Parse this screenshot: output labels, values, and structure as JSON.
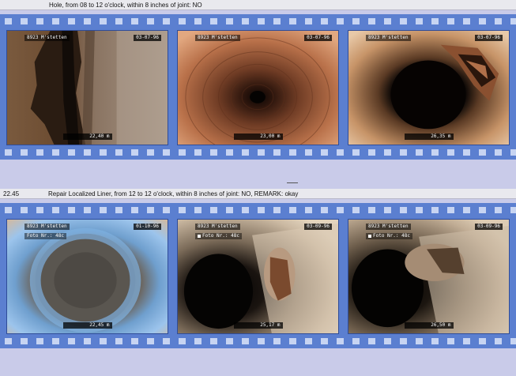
{
  "observations": [
    {
      "distance": "",
      "description": "Hole,  from 08 to 12 o'clock, within 8 inches of joint: NO",
      "frames": [
        {
          "location": "8923 M'stetten",
          "date": "03-07-96",
          "position": "22,40 m",
          "foto": "",
          "scene": "crack"
        },
        {
          "location": "8923 M'stetten",
          "date": "03-07-96",
          "position": "23,00 m",
          "foto": "",
          "scene": "rough-pipe"
        },
        {
          "location": "8923 M'stetten",
          "date": "03-07-96",
          "position": "26,35 m",
          "foto": "",
          "scene": "hole-pipe"
        }
      ]
    },
    {
      "distance": "22.45",
      "description": "Repair Localized Liner, from 12 to 12 o'clock, within 8 inches of joint: NO, REMARK: okay",
      "frames": [
        {
          "location": "8923 M'stetten",
          "date": "01-10-96",
          "position": "22,45 m",
          "foto": "Foto Nr.:   48c",
          "scene": "blue-liner"
        },
        {
          "location": "8923 M'stetten",
          "date": "03-09-96",
          "position": "25,17 m",
          "foto": "Foto Nr.:   48c",
          "scene": "liner-cut"
        },
        {
          "location": "8923 M'stetten",
          "date": "03-09-96",
          "position": "26,50 m",
          "foto": "Foto Nr.:   48c",
          "scene": "liner-cut-2"
        }
      ]
    }
  ]
}
